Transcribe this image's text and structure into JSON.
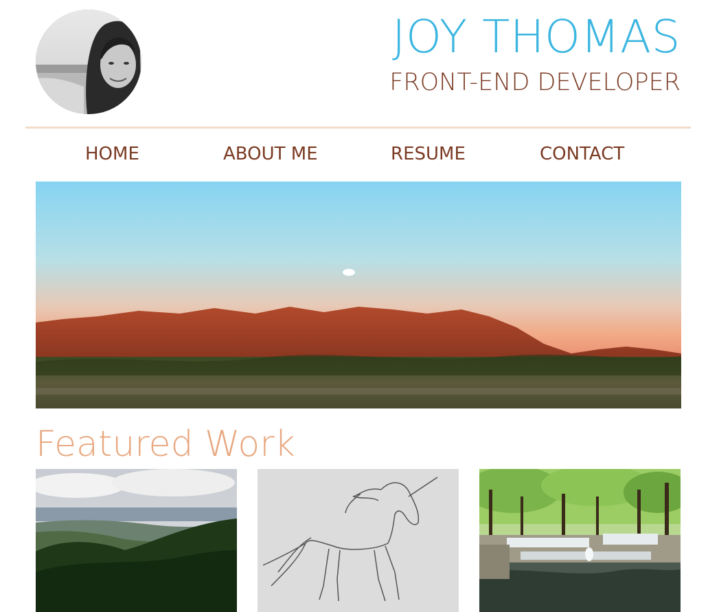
{
  "header": {
    "name": "JOY THOMAS",
    "role": "FRONT-END DEVELOPER",
    "avatar_alt": "avatar"
  },
  "nav": {
    "items": [
      {
        "label": "HOME"
      },
      {
        "label": "ABOUT ME"
      },
      {
        "label": "RESUME"
      },
      {
        "label": "CONTACT"
      }
    ]
  },
  "featured": {
    "title": "Featured Work"
  },
  "colors": {
    "name": "#3cb6e0",
    "role": "#7a3a22",
    "divider": "#f0dcc8",
    "section_title": "#e8a880"
  }
}
